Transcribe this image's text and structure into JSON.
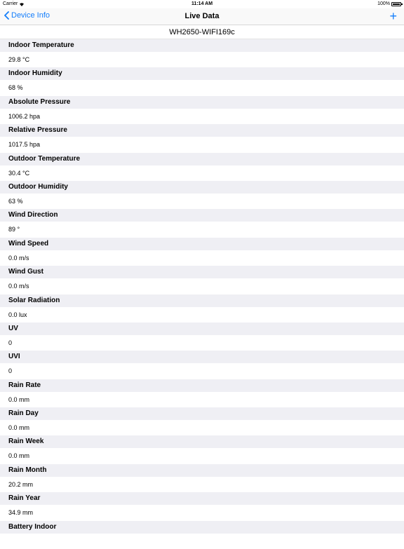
{
  "status_bar": {
    "carrier": "Carrier",
    "time": "11:14 AM",
    "battery": "100%"
  },
  "nav": {
    "back_label": "Device Info",
    "title": "Live Data",
    "add_label": "+"
  },
  "device_name": "WH2650-WIFI169c",
  "items": [
    {
      "label": "Indoor Temperature",
      "value": "29.8 °C"
    },
    {
      "label": "Indoor Humidity",
      "value": "68 %"
    },
    {
      "label": "Absolute Pressure",
      "value": "1006.2 hpa"
    },
    {
      "label": "Relative Pressure",
      "value": "1017.5 hpa"
    },
    {
      "label": "Outdoor Temperature",
      "value": "30.4 °C"
    },
    {
      "label": "Outdoor Humidity",
      "value": "63 %"
    },
    {
      "label": "Wind Direction",
      "value": "89 °"
    },
    {
      "label": "Wind Speed",
      "value": "0.0 m/s"
    },
    {
      "label": "Wind Gust",
      "value": "0.0 m/s"
    },
    {
      "label": "Solar Radiation",
      "value": "0.0 lux"
    },
    {
      "label": "UV",
      "value": "0"
    },
    {
      "label": "UVI",
      "value": "0"
    },
    {
      "label": "Rain Rate",
      "value": "0.0 mm"
    },
    {
      "label": "Rain Day",
      "value": "0.0 mm"
    },
    {
      "label": "Rain Week",
      "value": "0.0 mm"
    },
    {
      "label": "Rain Month",
      "value": "20.2 mm"
    },
    {
      "label": "Rain Year",
      "value": "34.9 mm"
    },
    {
      "label": "Battery Indoor",
      "value": ""
    }
  ]
}
